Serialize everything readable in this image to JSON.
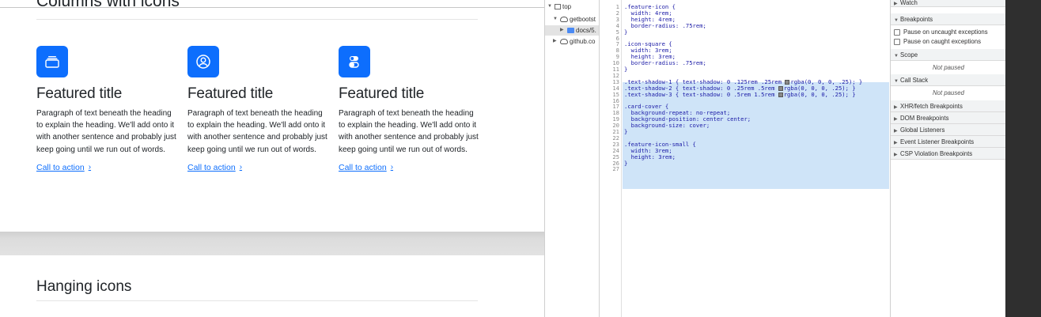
{
  "preview": {
    "section_title": "Columns with icons",
    "features": [
      {
        "title": "Featured title",
        "paragraph": "Paragraph of text beneath the heading to explain the heading. We'll add onto it with another sentence and probably just keep going until we run out of words.",
        "cta": "Call to action",
        "icon": "collection-icon"
      },
      {
        "title": "Featured title",
        "paragraph": "Paragraph of text beneath the heading to explain the heading. We'll add onto it with another sentence and probably just keep going until we run out of words.",
        "cta": "Call to action",
        "icon": "person-circle-icon"
      },
      {
        "title": "Featured title",
        "paragraph": "Paragraph of text beneath the heading to explain the heading. We'll add onto it with another sentence and probably just keep going until we run out of words.",
        "cta": "Call to action",
        "icon": "toggles-icon"
      }
    ],
    "cta_chevron": "›",
    "hanging_title": "Hanging icons",
    "accent_color": "#0d6efd"
  },
  "devtools": {
    "tree": [
      {
        "label": "top",
        "icon": "frame-icon"
      },
      {
        "label": "getbootst",
        "icon": "cloud-icon"
      },
      {
        "label": "docs/5.",
        "icon": "folder-icon"
      },
      {
        "label": "github.co",
        "icon": "cloud-icon"
      }
    ],
    "code_lines": [
      {
        "n": "1",
        "t": ".feature-icon {"
      },
      {
        "n": "2",
        "t": "  width: 4rem;"
      },
      {
        "n": "3",
        "t": "  height: 4rem;"
      },
      {
        "n": "4",
        "t": "  border-radius: .75rem;"
      },
      {
        "n": "5",
        "t": "}"
      },
      {
        "n": "6",
        "t": ""
      },
      {
        "n": "7",
        "t": ".icon-square {"
      },
      {
        "n": "8",
        "t": "  width: 3rem;"
      },
      {
        "n": "9",
        "t": "  height: 3rem;"
      },
      {
        "n": "10",
        "t": "  border-radius: .75rem;"
      },
      {
        "n": "11",
        "t": "}"
      },
      {
        "n": "12",
        "t": ""
      },
      {
        "n": "13",
        "t": ".text-shadow-1 { text-shadow: 0 .125rem .25rem ▣rgba(0, 0, 0, .25); }"
      },
      {
        "n": "14",
        "t": ".text-shadow-2 { text-shadow: 0 .25rem .5rem ▣rgba(0, 0, 0, .25); }"
      },
      {
        "n": "15",
        "t": ".text-shadow-3 { text-shadow: 0 .5rem 1.5rem ▣rgba(0, 0, 0, .25); }"
      },
      {
        "n": "16",
        "t": ""
      },
      {
        "n": "17",
        "t": ".card-cover {"
      },
      {
        "n": "18",
        "t": "  background-repeat: no-repeat;"
      },
      {
        "n": "19",
        "t": "  background-position: center center;"
      },
      {
        "n": "20",
        "t": "  background-size: cover;"
      },
      {
        "n": "21",
        "t": "}"
      },
      {
        "n": "22",
        "t": ""
      },
      {
        "n": "23",
        "t": ".feature-icon-small {"
      },
      {
        "n": "24",
        "t": "  width: 3rem;"
      },
      {
        "n": "25",
        "t": "  height: 3rem;"
      },
      {
        "n": "26",
        "t": "}"
      },
      {
        "n": "27",
        "t": ""
      }
    ],
    "debugger": {
      "watch": "Watch",
      "breakpoints": "Breakpoints",
      "pause_uncaught": "Pause on uncaught exceptions",
      "pause_caught": "Pause on caught exceptions",
      "scope": "Scope",
      "scope_note": "Not paused",
      "call_stack": "Call Stack",
      "call_stack_note": "Not paused",
      "xhr": "XHR/fetch Breakpoints",
      "dom": "DOM Breakpoints",
      "global": "Global Listeners",
      "event": "Event Listener Breakpoints",
      "csp": "CSP Violation Breakpoints"
    }
  }
}
